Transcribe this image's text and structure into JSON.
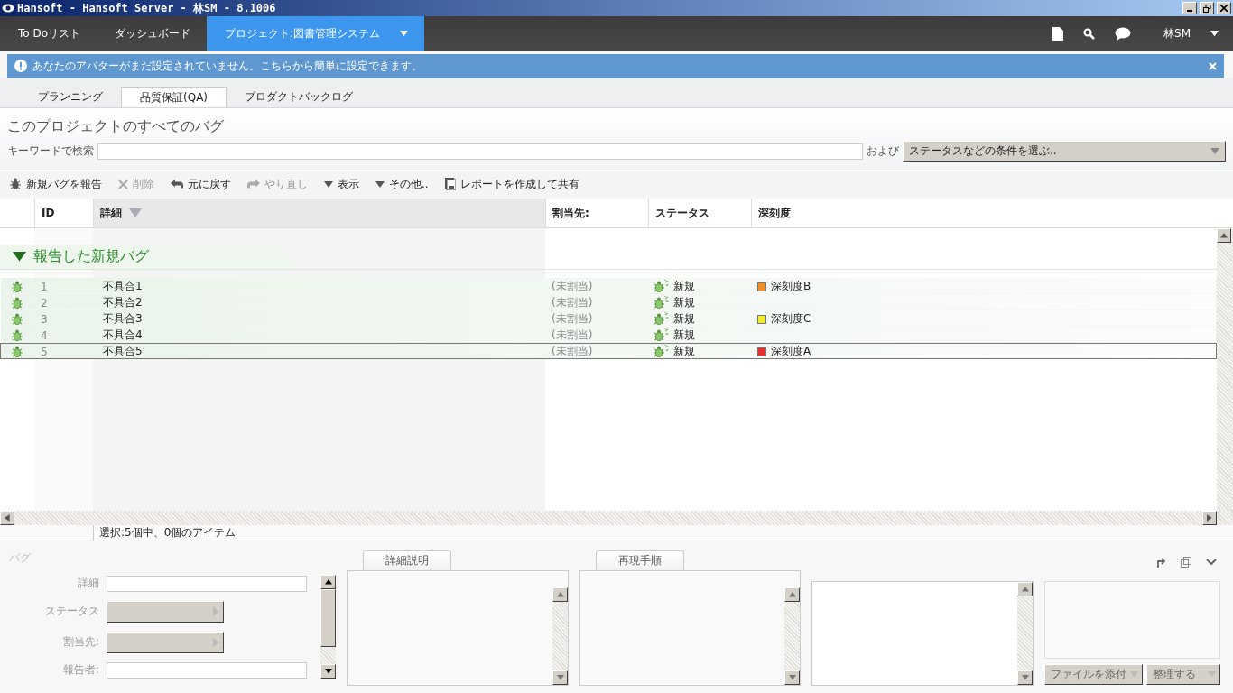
{
  "window": {
    "title": "Hansoft - Hansoft Server - 林SM - 8.1006"
  },
  "nav": {
    "tabs": [
      {
        "label": "To Doリスト",
        "selected": false,
        "has_menu": false
      },
      {
        "label": "ダッシュボード",
        "selected": false,
        "has_menu": false
      },
      {
        "label": "プロジェクト:図書管理システム",
        "selected": true,
        "has_menu": true
      }
    ],
    "user": "林SM"
  },
  "notice": {
    "text": "あなたのアバターがまだ設定されていません。こちらから簡単に設定できます。"
  },
  "sub_tabs": [
    {
      "label": "プランニング",
      "selected": false
    },
    {
      "label": "品質保証(QA)",
      "selected": true
    },
    {
      "label": "プロダクトバックログ",
      "selected": false
    }
  ],
  "page_title": "このプロジェクトのすべてのバグ",
  "search": {
    "label": "キーワードで検索",
    "connector": "および",
    "filter": "ステータスなどの条件を選ぶ.."
  },
  "toolbar": [
    {
      "kind": "bug",
      "label": "新規バグを報告",
      "disabled": false
    },
    {
      "kind": "delete",
      "label": "削除",
      "disabled": true
    },
    {
      "kind": "undo",
      "label": "元に戻す",
      "disabled": false
    },
    {
      "kind": "redo",
      "label": "やり直し",
      "disabled": true
    },
    {
      "kind": "menu",
      "label": "表示",
      "disabled": false
    },
    {
      "kind": "menu",
      "label": "その他..",
      "disabled": false
    },
    {
      "kind": "report",
      "label": "レポートを作成して共有",
      "disabled": false
    }
  ],
  "columns": [
    {
      "label": "ID",
      "sorted": false
    },
    {
      "label": "詳細",
      "sorted": true
    },
    {
      "label": "割当先:",
      "sorted": false
    },
    {
      "label": "ステータス",
      "sorted": false
    },
    {
      "label": "深刻度",
      "sorted": false
    }
  ],
  "group": {
    "title": "報告した新規バグ",
    "expanded": true,
    "rows": [
      {
        "id": "1",
        "detail": "不具合1",
        "assignee": "(未割当)",
        "status": "新規",
        "severity": {
          "label": "深刻度B",
          "color": "#f0902a"
        },
        "selected": false
      },
      {
        "id": "2",
        "detail": "不具合2",
        "assignee": "(未割当)",
        "status": "新規",
        "selected": false
      },
      {
        "id": "3",
        "detail": "不具合3",
        "assignee": "(未割当)",
        "status": "新規",
        "severity": {
          "label": "深刻度C",
          "color": "#f4ec30"
        },
        "selected": false
      },
      {
        "id": "4",
        "detail": "不具合4",
        "assignee": "(未割当)",
        "status": "新規",
        "selected": false
      },
      {
        "id": "5",
        "detail": "不具合5",
        "assignee": "(未割当)",
        "status": "新規",
        "severity": {
          "label": "深刻度A",
          "color": "#e83030"
        },
        "selected": true
      }
    ]
  },
  "status_bar": "選択:5個中、0個のアイテム",
  "detail_panel": {
    "title": "バグ",
    "fields": [
      {
        "label": "詳細",
        "kind": "text"
      },
      {
        "label": "ステータス",
        "kind": "dropdown"
      },
      {
        "label": "割当先:",
        "kind": "dropdown"
      },
      {
        "label": "報告者:",
        "kind": "text"
      }
    ],
    "tabs": [
      "詳細説明",
      "再現手順"
    ],
    "buttons": [
      "ファイルを添付",
      "整理する"
    ]
  }
}
